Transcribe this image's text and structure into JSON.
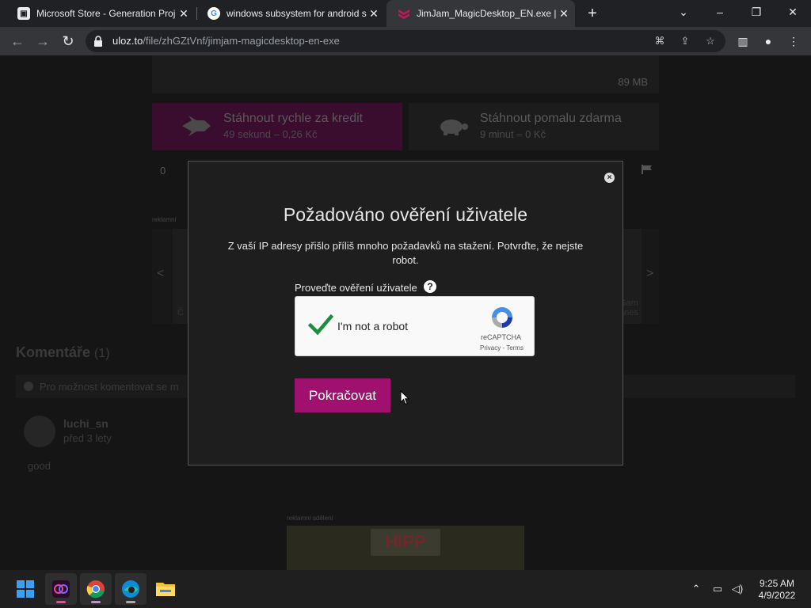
{
  "browser": {
    "tabs": [
      {
        "title": "Microsoft Store - Generation Proj",
        "favicon": "store-icon"
      },
      {
        "title": "windows subsystem for android s",
        "favicon": "google-icon"
      },
      {
        "title": "JimJam_MagicDesktop_EN.exe | U",
        "favicon": "uloz-icon",
        "active": true
      }
    ],
    "url_domain": "uloz.to",
    "url_path": "/file/zhGZtVnf/jimjam-magicdesktop-en-exe"
  },
  "page": {
    "file_size": "89 MB",
    "download_fast": {
      "title": "Stáhnout rychle za kredit",
      "sub": "49 sekund – 0,26 Kč"
    },
    "download_slow": {
      "title": "Stáhnout pomalu zdarma",
      "sub": "9 minut – 0 Kč"
    },
    "like_count": "0",
    "ad_label": "reklamní",
    "ad_label_bottom": "reklamní sdělení",
    "carousel_left_text": "Č",
    "carousel_right_text": "Gam\nanes",
    "comments_heading": "Komentáře",
    "comments_count": "(1)",
    "comments_notice": "Pro možnost komentovat se m",
    "comment": {
      "user": "luchi_sn",
      "time": "před 3 lety",
      "text": "good"
    },
    "bottom_ad_brand": "HiPP"
  },
  "modal": {
    "title": "Požadováno ověření uživatele",
    "text": "Z vaší IP adresy přišlo příliš mnoho požadavků na stažení. Potvrďte, že nejste robot.",
    "verify_label": "Proveďte ověření uživatele",
    "help_glyph": "?",
    "close_glyph": "×",
    "recaptcha": {
      "label": "I'm not a robot",
      "brand": "reCAPTCHA",
      "terms": "Privacy - Terms",
      "checked": true
    },
    "continue_button": "Pokračovat"
  },
  "taskbar": {
    "time": "9:25 AM",
    "date": "4/9/2022"
  },
  "colors": {
    "accent": "#a0106e",
    "check": "#1e8e3e"
  }
}
